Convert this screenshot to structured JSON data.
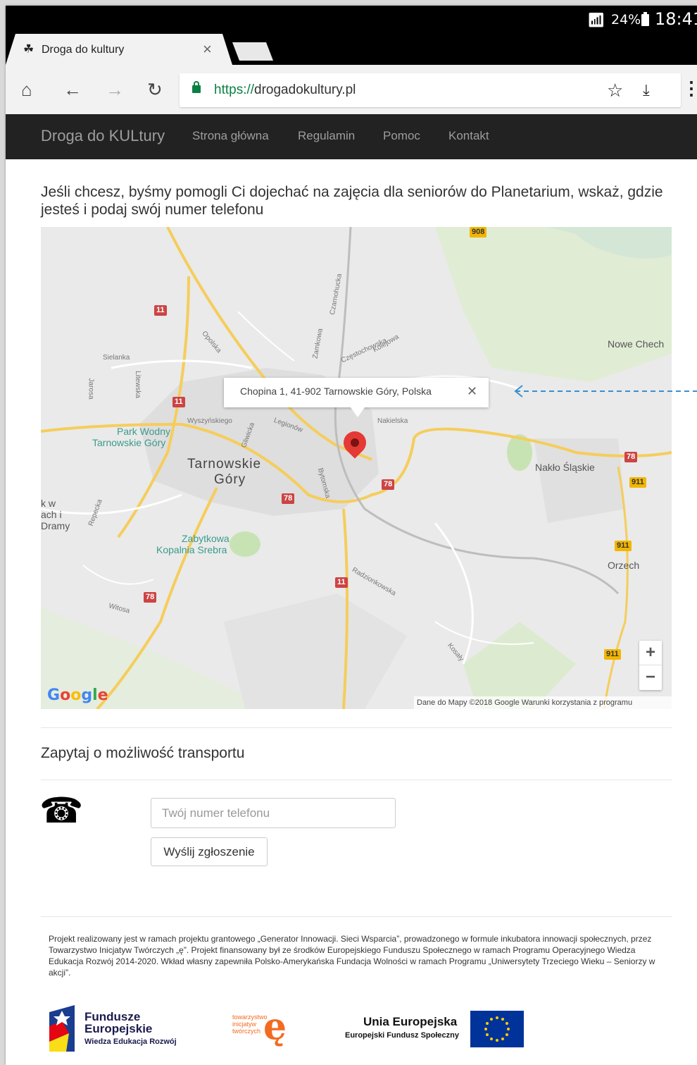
{
  "status_bar": {
    "battery": "24%",
    "time": "18:41"
  },
  "tab": {
    "title": "Droga do kultury",
    "close": "×"
  },
  "toolbar": {
    "url_scheme": "https://",
    "url_host": "drogadokultury.pl"
  },
  "navbar": {
    "brand": "Droga do KULtury",
    "items": [
      "Strona główna",
      "Regulamin",
      "Pomoc",
      "Kontakt"
    ]
  },
  "intro": "Jeśli chcesz, byśmy pomogli Ci dojechać na zajęcia dla seniorów do Planetarium, wskaż, gdzie jesteś i podaj swój numer telefonu",
  "map": {
    "infowindow_address": "Chopina 1, 41-902 Tarnowskie Góry, Polska",
    "labels": {
      "city": "Tarnowskie",
      "city2": "Góry",
      "nowe": "Nowe Chech",
      "naklo": "Nakło Śląskie",
      "orzech": "Orzech",
      "park1": "Park Wodny",
      "park2": "Tarnowskie Góry",
      "zab1": "Zabytkowa",
      "zab2": "Kopalnia Srebra",
      "kw1": "k w",
      "kw2": "ach i",
      "kw3": "Dramy"
    },
    "streets": [
      "Sielanka",
      "Opolska",
      "Gliwicka",
      "Legionów",
      "Nakielska",
      "Bytomska",
      "Częstochowska",
      "Wyszyńskiego",
      "Jarosa",
      "Litewska",
      "Repecka",
      "Witosa",
      "Radzionkowska",
      "Kosały",
      "Zamkowa",
      "Czarnohucka",
      "Kolejowa"
    ],
    "shields": [
      "11",
      "11",
      "11",
      "78",
      "78",
      "78",
      "78",
      "911",
      "911",
      "911",
      "908"
    ],
    "google": "Google",
    "terms": "Dane do Mapy ©2018 Google    Warunki korzystania z programu",
    "zoom_in": "+",
    "zoom_out": "−"
  },
  "transport": {
    "title": "Zapytaj o możliwość transportu",
    "phone_placeholder": "Twój numer telefonu",
    "submit": "Wyślij zgłoszenie"
  },
  "footer": {
    "text": "Projekt realizowany jest w ramach projektu grantowego „Generator  Innowacji. Sieci Wsparcia”, prowadzonego w formule inkubatora innowacji społecznych, przez Towarzystwo Inicjatyw Twórczych „ę”. Projekt finansowany był ze środków Europejskiego Funduszu Społecznego w ramach Programu Operacyjnego Wiedza Edukacja Rozwój 2014-2020. Wkład własny zapewniła Polsko-Amerykańska Fundacja Wolności w ramach Programu „Uniwersytety Trzeciego Wieku – Seniorzy w akcji”.",
    "fe_line1": "Fundusze",
    "fe_line2": "Europejskie",
    "fe_line3": "Wiedza Edukacja Rozwój",
    "tit_small": "towarzystwo inicjatyw twórczych",
    "tit_letter": "ę",
    "ue_line1": "Unia Europejska",
    "ue_line2": "Europejski Fundusz Społeczny"
  },
  "colors": {
    "navbar": "#222222",
    "accent_green": "#0b8043",
    "pin": "#e53935",
    "eu_blue": "#003399",
    "tit_orange": "#f26b21"
  }
}
